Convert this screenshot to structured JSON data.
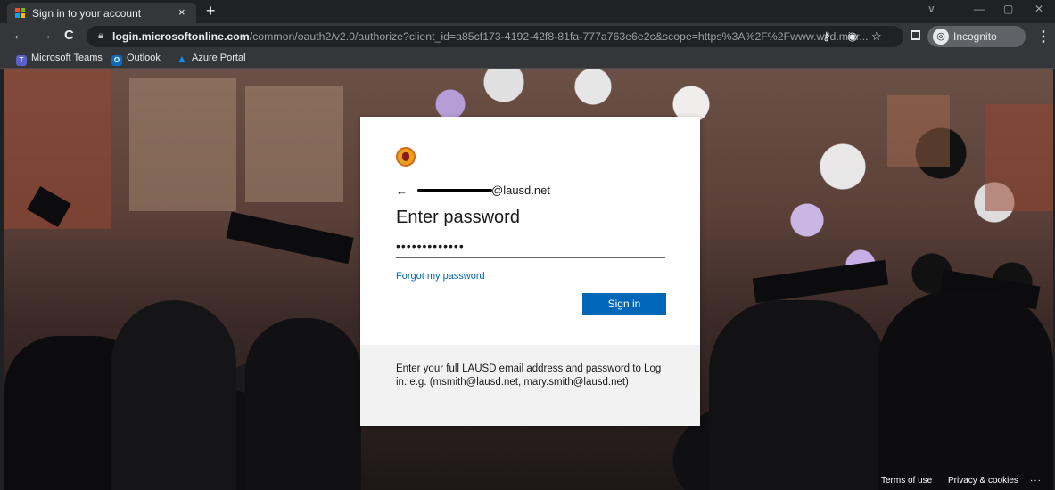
{
  "browser": {
    "tab_title": "Sign in to your account",
    "tab_close": "×",
    "new_tab": "+",
    "window_controls": [
      "∨",
      "—",
      "▢",
      "✕"
    ],
    "url_host": "login.microsoftonline.com",
    "url_path": "/common/oauth2/v2.0/authorize?client_id=a85cf173-4192-42f8-81fa-777a763e6e2c&scope=https%3A%2F%2Fwww.wvd.micr...",
    "incognito_label": "Incognito",
    "nav": {
      "back": "←",
      "forward": "→",
      "reload": "C"
    },
    "bookmarks": [
      {
        "label": "Microsoft Teams",
        "icon": "teams-icon",
        "color": "#5b5fc7"
      },
      {
        "label": "Outlook",
        "icon": "outlook-icon",
        "color": "#0f6cbd"
      },
      {
        "label": "Azure Portal",
        "icon": "azure-icon",
        "color": "#0a8ef0"
      }
    ]
  },
  "login": {
    "back_arrow": "←",
    "email_suffix": "@lausd.net",
    "heading": "Enter password",
    "password_masked": "•••••••••••••",
    "forgot_link": "Forgot my password",
    "signin_button": "Sign in",
    "hint": "Enter your full LAUSD email address and password to Log in. e.g. (msmith@lausd.net, mary.smith@lausd.net)",
    "accent_color": "#0067b8"
  },
  "footer": {
    "terms": "Terms of use",
    "privacy": "Privacy & cookies",
    "more": "···"
  }
}
